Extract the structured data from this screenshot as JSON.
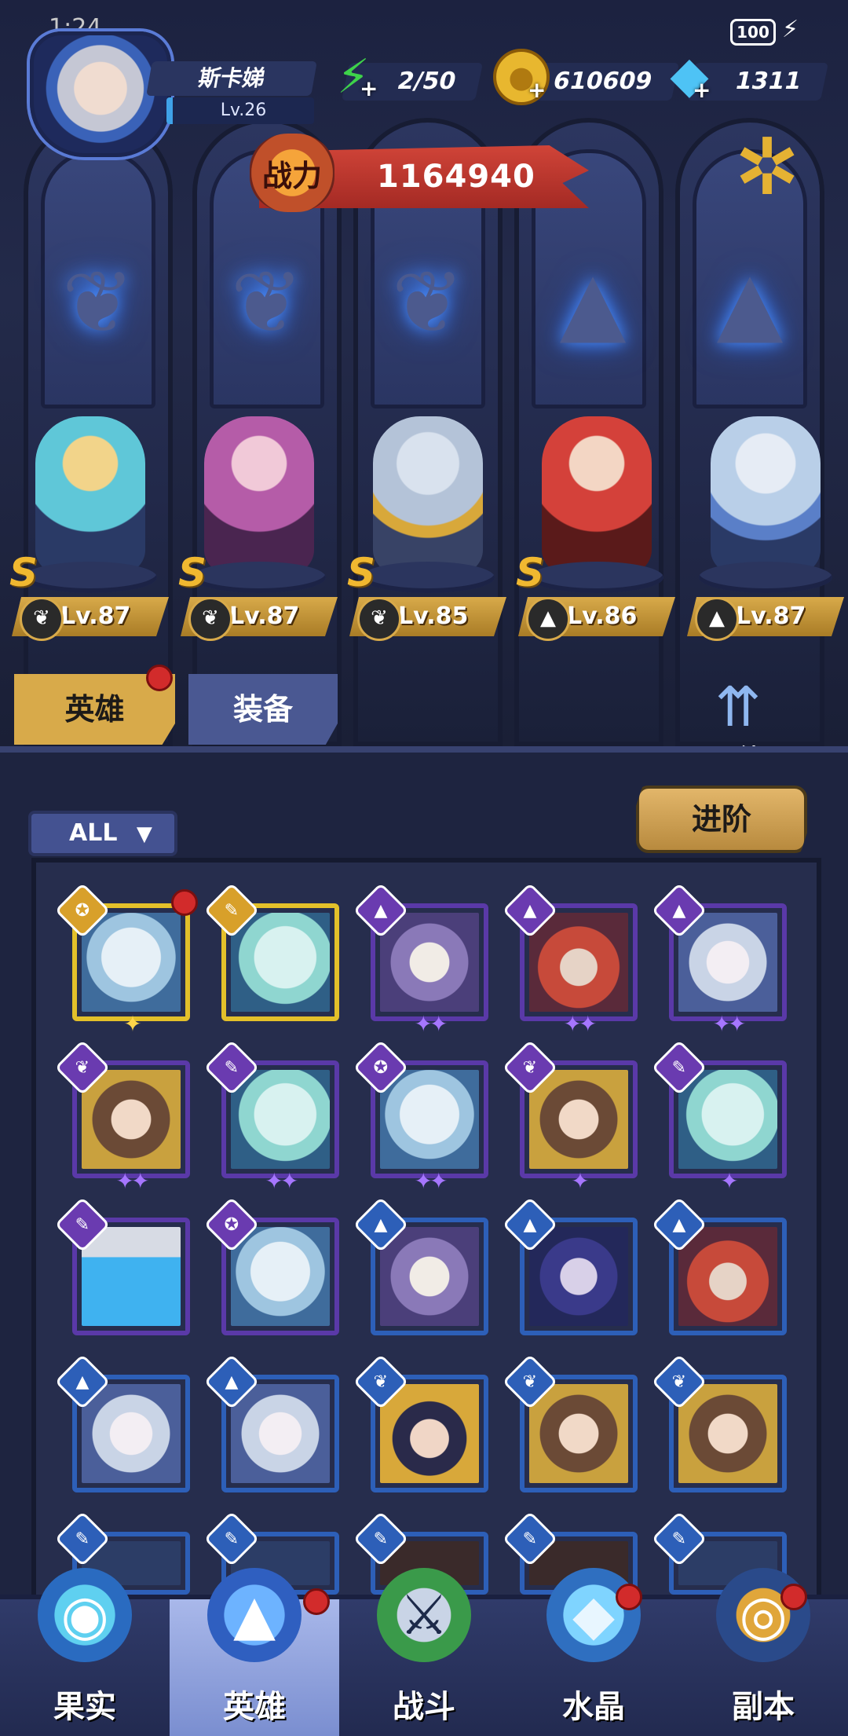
{
  "status_bar": {
    "time": "1:24",
    "battery": "100"
  },
  "player": {
    "name": "斯卡娣",
    "level": "Lv.26"
  },
  "resources": {
    "energy": "2/50",
    "gold": "610609",
    "gems": "1311"
  },
  "combat_power": {
    "label": "战力",
    "value": "1164940"
  },
  "heroes": [
    {
      "level": "Lv.87",
      "grade": "S",
      "class_icon": "wing-icon"
    },
    {
      "level": "Lv.87",
      "grade": "S",
      "class_icon": "wing-icon"
    },
    {
      "level": "Lv.85",
      "grade": "S",
      "class_icon": "wing-icon"
    },
    {
      "level": "Lv.86",
      "grade": "S",
      "class_icon": "hat-icon"
    },
    {
      "level": "Lv.87",
      "grade": "",
      "class_icon": "hat-icon"
    }
  ],
  "tabs": {
    "heroes": "英雄",
    "equipment": "装备"
  },
  "bond": {
    "label": "羁绊"
  },
  "filter": {
    "label": "ALL"
  },
  "advance": {
    "label": "进阶"
  },
  "nav": [
    {
      "label": "果实",
      "icon": "fruit-icon"
    },
    {
      "label": "英雄",
      "icon": "wizard-hat-icon"
    },
    {
      "label": "战斗",
      "icon": "battle-icon"
    },
    {
      "label": "水晶",
      "icon": "crystal-icon"
    },
    {
      "label": "副本",
      "icon": "portal-icon"
    }
  ],
  "colors": {
    "accent_gold": "#d8aa4a",
    "power_red": "#c6362d",
    "card_gold": "#e3c02a",
    "card_purple": "#5a39a8",
    "card_blue": "#2d5fb8",
    "notification_red": "#d22b2b"
  }
}
